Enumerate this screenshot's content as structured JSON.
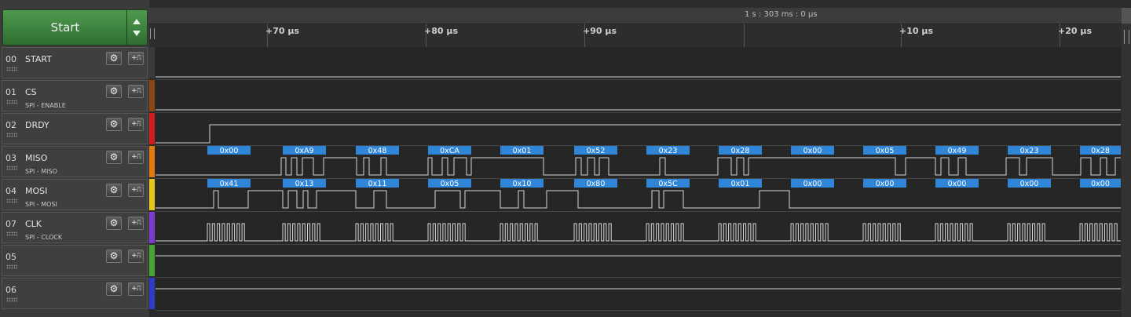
{
  "start_button": {
    "label": "Start"
  },
  "ruler": {
    "absolute_time": "1 s : 303 ms : 0 μs",
    "ticks": [
      "+70 μs",
      "+80 μs",
      "+90 μs",
      "+10 μs",
      "+20 μs"
    ]
  },
  "channels": [
    {
      "num": "00",
      "name": "START",
      "sub": "",
      "color": "#3a3a3a"
    },
    {
      "num": "01",
      "name": "CS",
      "sub": "SPI - ENABLE",
      "color": "#8b4513"
    },
    {
      "num": "02",
      "name": "DRDY",
      "sub": "",
      "color": "#d11d1d"
    },
    {
      "num": "03",
      "name": "MISO",
      "sub": "SPI - MISO",
      "color": "#e07b12"
    },
    {
      "num": "04",
      "name": "MOSI",
      "sub": "SPI - MOSI",
      "color": "#e6c619"
    },
    {
      "num": "07",
      "name": "CLK",
      "sub": "SPI - CLOCK",
      "color": "#7d3bd0"
    },
    {
      "num": "05",
      "name": "",
      "sub": "",
      "color": "#45a52c"
    },
    {
      "num": "06",
      "name": "",
      "sub": "",
      "color": "#2c3cc4"
    }
  ],
  "miso_bytes": [
    "0x00",
    "0xA9",
    "0x48",
    "0xCA",
    "0x01",
    "0x52",
    "0x23",
    "0x28",
    "0x00",
    "0x05",
    "0x49",
    "0x23",
    "0x28"
  ],
  "mosi_bytes": [
    "0x41",
    "0x13",
    "0x11",
    "0x05",
    "0x10",
    "0x80",
    "0x5C",
    "0x01",
    "0x00",
    "0x00",
    "0x00",
    "0x00",
    "0x00"
  ],
  "colors": {
    "byte_bubble": "#2f86d8",
    "trace": "#d6d6d6",
    "panel": "#3f3f3f"
  }
}
